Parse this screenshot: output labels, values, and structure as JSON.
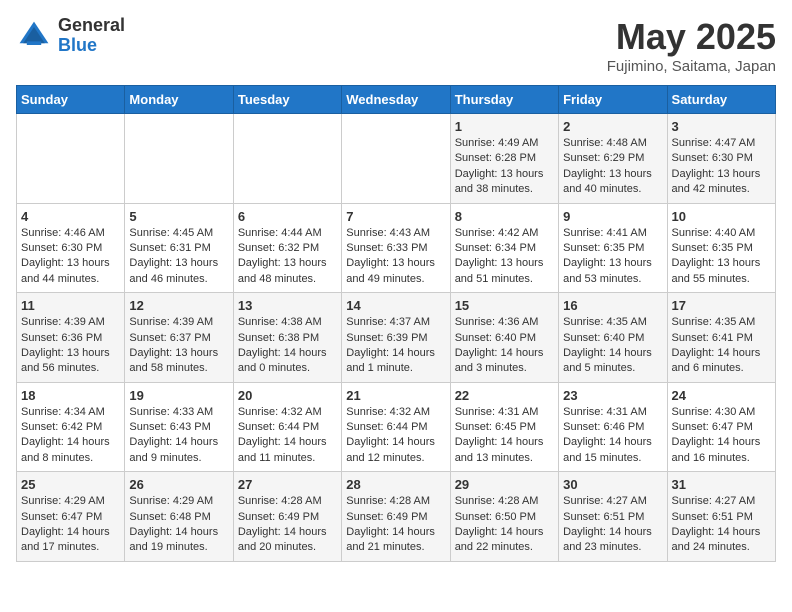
{
  "logo": {
    "general": "General",
    "blue": "Blue"
  },
  "title": {
    "month_year": "May 2025",
    "location": "Fujimino, Saitama, Japan"
  },
  "days_of_week": [
    "Sunday",
    "Monday",
    "Tuesday",
    "Wednesday",
    "Thursday",
    "Friday",
    "Saturday"
  ],
  "weeks": [
    [
      {
        "day": "",
        "info": ""
      },
      {
        "day": "",
        "info": ""
      },
      {
        "day": "",
        "info": ""
      },
      {
        "day": "",
        "info": ""
      },
      {
        "day": "1",
        "info": "Sunrise: 4:49 AM\nSunset: 6:28 PM\nDaylight: 13 hours\nand 38 minutes."
      },
      {
        "day": "2",
        "info": "Sunrise: 4:48 AM\nSunset: 6:29 PM\nDaylight: 13 hours\nand 40 minutes."
      },
      {
        "day": "3",
        "info": "Sunrise: 4:47 AM\nSunset: 6:30 PM\nDaylight: 13 hours\nand 42 minutes."
      }
    ],
    [
      {
        "day": "4",
        "info": "Sunrise: 4:46 AM\nSunset: 6:30 PM\nDaylight: 13 hours\nand 44 minutes."
      },
      {
        "day": "5",
        "info": "Sunrise: 4:45 AM\nSunset: 6:31 PM\nDaylight: 13 hours\nand 46 minutes."
      },
      {
        "day": "6",
        "info": "Sunrise: 4:44 AM\nSunset: 6:32 PM\nDaylight: 13 hours\nand 48 minutes."
      },
      {
        "day": "7",
        "info": "Sunrise: 4:43 AM\nSunset: 6:33 PM\nDaylight: 13 hours\nand 49 minutes."
      },
      {
        "day": "8",
        "info": "Sunrise: 4:42 AM\nSunset: 6:34 PM\nDaylight: 13 hours\nand 51 minutes."
      },
      {
        "day": "9",
        "info": "Sunrise: 4:41 AM\nSunset: 6:35 PM\nDaylight: 13 hours\nand 53 minutes."
      },
      {
        "day": "10",
        "info": "Sunrise: 4:40 AM\nSunset: 6:35 PM\nDaylight: 13 hours\nand 55 minutes."
      }
    ],
    [
      {
        "day": "11",
        "info": "Sunrise: 4:39 AM\nSunset: 6:36 PM\nDaylight: 13 hours\nand 56 minutes."
      },
      {
        "day": "12",
        "info": "Sunrise: 4:39 AM\nSunset: 6:37 PM\nDaylight: 13 hours\nand 58 minutes."
      },
      {
        "day": "13",
        "info": "Sunrise: 4:38 AM\nSunset: 6:38 PM\nDaylight: 14 hours\nand 0 minutes."
      },
      {
        "day": "14",
        "info": "Sunrise: 4:37 AM\nSunset: 6:39 PM\nDaylight: 14 hours\nand 1 minute."
      },
      {
        "day": "15",
        "info": "Sunrise: 4:36 AM\nSunset: 6:40 PM\nDaylight: 14 hours\nand 3 minutes."
      },
      {
        "day": "16",
        "info": "Sunrise: 4:35 AM\nSunset: 6:40 PM\nDaylight: 14 hours\nand 5 minutes."
      },
      {
        "day": "17",
        "info": "Sunrise: 4:35 AM\nSunset: 6:41 PM\nDaylight: 14 hours\nand 6 minutes."
      }
    ],
    [
      {
        "day": "18",
        "info": "Sunrise: 4:34 AM\nSunset: 6:42 PM\nDaylight: 14 hours\nand 8 minutes."
      },
      {
        "day": "19",
        "info": "Sunrise: 4:33 AM\nSunset: 6:43 PM\nDaylight: 14 hours\nand 9 minutes."
      },
      {
        "day": "20",
        "info": "Sunrise: 4:32 AM\nSunset: 6:44 PM\nDaylight: 14 hours\nand 11 minutes."
      },
      {
        "day": "21",
        "info": "Sunrise: 4:32 AM\nSunset: 6:44 PM\nDaylight: 14 hours\nand 12 minutes."
      },
      {
        "day": "22",
        "info": "Sunrise: 4:31 AM\nSunset: 6:45 PM\nDaylight: 14 hours\nand 13 minutes."
      },
      {
        "day": "23",
        "info": "Sunrise: 4:31 AM\nSunset: 6:46 PM\nDaylight: 14 hours\nand 15 minutes."
      },
      {
        "day": "24",
        "info": "Sunrise: 4:30 AM\nSunset: 6:47 PM\nDaylight: 14 hours\nand 16 minutes."
      }
    ],
    [
      {
        "day": "25",
        "info": "Sunrise: 4:29 AM\nSunset: 6:47 PM\nDaylight: 14 hours\nand 17 minutes."
      },
      {
        "day": "26",
        "info": "Sunrise: 4:29 AM\nSunset: 6:48 PM\nDaylight: 14 hours\nand 19 minutes."
      },
      {
        "day": "27",
        "info": "Sunrise: 4:28 AM\nSunset: 6:49 PM\nDaylight: 14 hours\nand 20 minutes."
      },
      {
        "day": "28",
        "info": "Sunrise: 4:28 AM\nSunset: 6:49 PM\nDaylight: 14 hours\nand 21 minutes."
      },
      {
        "day": "29",
        "info": "Sunrise: 4:28 AM\nSunset: 6:50 PM\nDaylight: 14 hours\nand 22 minutes."
      },
      {
        "day": "30",
        "info": "Sunrise: 4:27 AM\nSunset: 6:51 PM\nDaylight: 14 hours\nand 23 minutes."
      },
      {
        "day": "31",
        "info": "Sunrise: 4:27 AM\nSunset: 6:51 PM\nDaylight: 14 hours\nand 24 minutes."
      }
    ]
  ]
}
